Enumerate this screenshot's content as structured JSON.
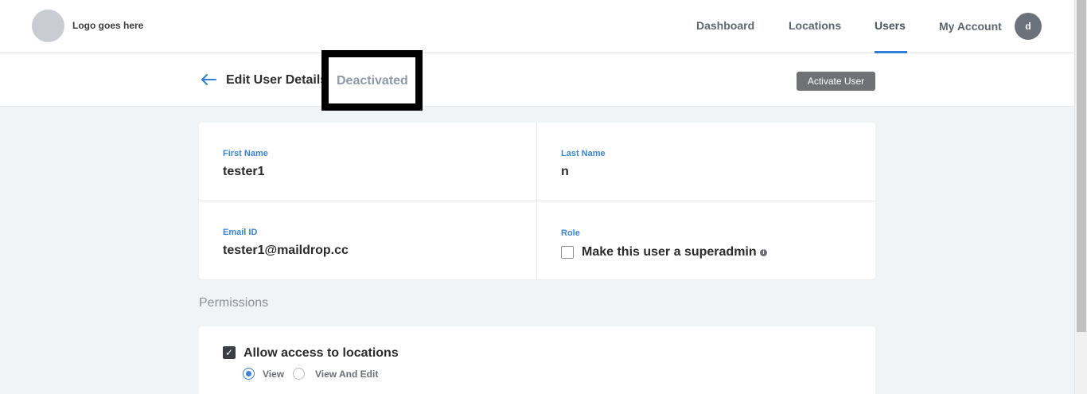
{
  "nav": {
    "logo_text": "Logo goes here",
    "links": [
      "Dashboard",
      "Locations",
      "Users",
      "My Account"
    ],
    "active": "Users",
    "avatar_initial": "d"
  },
  "header": {
    "title": "Edit User Details",
    "status": "Deactivated",
    "action_label": "Activate User"
  },
  "details": {
    "first_name_label": "First Name",
    "first_name": "tester1",
    "last_name_label": "Last Name",
    "last_name": "n",
    "email_label": "Email ID",
    "email": "tester1@maildrop.cc",
    "role_label": "Role",
    "superadmin_label": "Make this user a superadmin",
    "superadmin_checked": false
  },
  "permissions": {
    "section_title": "Permissions",
    "locations_label": "Allow access to locations",
    "locations_checked": true,
    "options": [
      "View",
      "View And Edit"
    ],
    "selected_option": "View"
  },
  "colors": {
    "accent": "#2f7fd6",
    "label_blue": "#3c84d6",
    "button_gray": "#6f7175"
  },
  "icons": [
    "back-arrow-icon",
    "info-icon",
    "check-icon"
  ]
}
